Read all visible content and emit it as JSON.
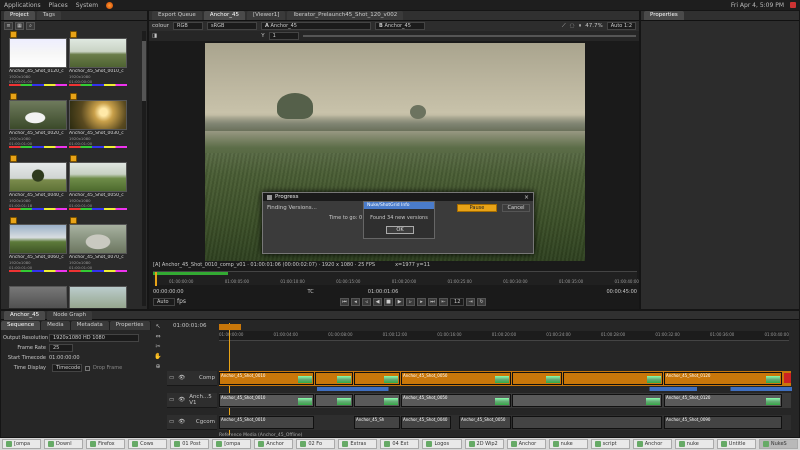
{
  "colors": {
    "accent_orange": "#e8a317",
    "clip_orange": "#c9770a",
    "clip_blue": "#3f6fbf",
    "playhead": "#e8a317",
    "selected_blue": "#4a7ccb"
  },
  "system": {
    "menu": [
      "Applications",
      "Places",
      "System"
    ],
    "clock": "Fri Apr 4, 5:09 PM"
  },
  "left_panel": {
    "tabs": [
      "Project",
      "Tags"
    ],
    "thumbnails": [
      {
        "name": "Anchor_45_Shot_0120_c",
        "res": "1920x1080",
        "fps": "16F p25FPS",
        "tc": "01:00:01:00",
        "img": "field"
      },
      {
        "name": "Anchor_45_Shot_0010_c",
        "res": "1920x1080",
        "fps": "14F p25FPS",
        "tc": "01:00:00:00",
        "img": "field"
      },
      {
        "name": "Anchor_45_Shot_0020_c",
        "res": "1920x1080",
        "fps": "16F p25FPS",
        "tc": "01:00:01:00",
        "img": "cows"
      },
      {
        "name": "Anchor_45_Shot_0030_c",
        "res": "1920x1080",
        "fps": "6F p25FPS",
        "tc": "01:00:01:00",
        "img": "sunset"
      },
      {
        "name": "Anchor_45_Shot_0040_c",
        "res": "1920x1080",
        "fps": "16F p25FPS",
        "tc": "01:00:01:18",
        "img": "tree"
      },
      {
        "name": "Anchor_45_Shot_0050_c",
        "res": "1920x1080",
        "fps": "16F p25FPS",
        "tc": "01:00:01:00",
        "img": "field"
      },
      {
        "name": "Anchor_45_Shot_0060_c",
        "res": "1920x1080",
        "fps": "14F p25FPS",
        "tc": "01:00:01:00",
        "img": "house"
      },
      {
        "name": "Anchor_45_Shot_0070_c",
        "res": "1920x1080",
        "fps": "16F p25FPS",
        "tc": "01:00:01:00",
        "img": "rock"
      },
      {
        "name": "",
        "res": "",
        "fps": "",
        "tc": "",
        "img": "cows"
      },
      {
        "name": "",
        "res": "",
        "fps": "",
        "tc": "",
        "img": "field"
      }
    ]
  },
  "center": {
    "tabs": [
      "Export Queue",
      "Anchor_45",
      "[Viewer1]",
      "Iberator_Prelaunch45_Shot_120_v002"
    ],
    "toolbar": {
      "colour_label": "colour",
      "rgb": "RGB",
      "srgb": "sRGB",
      "y_label": "Y",
      "y_value": "1",
      "a_label": "A",
      "a_value": "Anchor_45",
      "b_label": "B",
      "b_value": "Anchor_45",
      "zoom": "47.7%",
      "fit": "Auto 1:2"
    },
    "status": "[A] Anchor_45_Shot_0010_comp_v01 · 01:00:01:06 (00:00:02:07) · 1920 x 1080 · 25 FPS",
    "coords": "x=1977 y=11",
    "timecode_left": "00:00:00:00",
    "timecode_mid": "01:00:01:06",
    "timecode_right": "00:00:45:00",
    "tc_label": "TC",
    "auto": "Auto",
    "fps_label": "fps",
    "frame_step": "12",
    "ruler_ticks": [
      "01:00:00:00",
      "01:00:05:00",
      "01:00:10:00",
      "01:00:15:00",
      "01:00:20:00",
      "01:00:25:00",
      "01:00:30:00",
      "01:00:35:00",
      "01:00:40:00"
    ]
  },
  "dialog": {
    "title": "Progress",
    "message": "Finding Versions...",
    "time_text": "Time to go: 0 se",
    "status_pill": "Nuke/ShotGrid Info",
    "found": "Found 34 new versions",
    "ok": "OK",
    "pause": "Pause",
    "cancel": "Cancel"
  },
  "right_panel": {
    "title": "Properties"
  },
  "bottom": {
    "panel_tabs": [
      "Anchor_45",
      "Node Graph"
    ],
    "prop_tabs": [
      "Sequence",
      "Media",
      "Metadata",
      "Properties"
    ],
    "props": [
      {
        "label": "Output Resolution",
        "value": "1920x1080 HD 1080"
      },
      {
        "label": "Frame Rate",
        "value": "25"
      },
      {
        "label": "Start Timecode",
        "value": "01:00:00:00"
      },
      {
        "label": "Time Display",
        "value": "Timecode",
        "extra": "Drop Frame"
      }
    ],
    "timeline_tc": "01:00:01:06",
    "ruler": [
      "01:00:00:00",
      "01:00:04:00",
      "01:00:08:00",
      "01:00:12:00",
      "01:00:16:00",
      "01:00:20:00",
      "01:00:24:00",
      "01:00:28:00",
      "01:00:32:00",
      "01:00:36:00",
      "01:00:40:00"
    ],
    "tracks": [
      "Comp",
      "Anch...5 V1",
      "Cgcom"
    ],
    "comp_clips": [
      "Anchor_45_Shot_0010",
      "Anchor_45_Shot_0050",
      "Anchor_45_Shot_0120"
    ],
    "v1_clips": [
      "Anchor_45_Shot_0010",
      "Anchor_45_Shot_0050",
      "Anchor_45_Shot_0120"
    ],
    "cg_clips": [
      "Anchor_45_Shot_0010",
      "Anchor_45_Sh",
      "Anchor_45_Shot_0040",
      "Anchor_45_Shot_0050",
      "Anchor_45_Shot_0090"
    ],
    "status": "Reference Media (Anchor_45_Offline)"
  },
  "taskbar": [
    "[ompa",
    "Downl",
    "Firefox",
    "Cows",
    "01 Post",
    "[ompa",
    "Anchor",
    "02 Fo",
    "Extras",
    "04 Ext",
    "Logos",
    "2D Wip2",
    "Anchor",
    "nuke",
    "script",
    "Anchor",
    "nuke",
    "Untitle",
    "NukeS"
  ]
}
